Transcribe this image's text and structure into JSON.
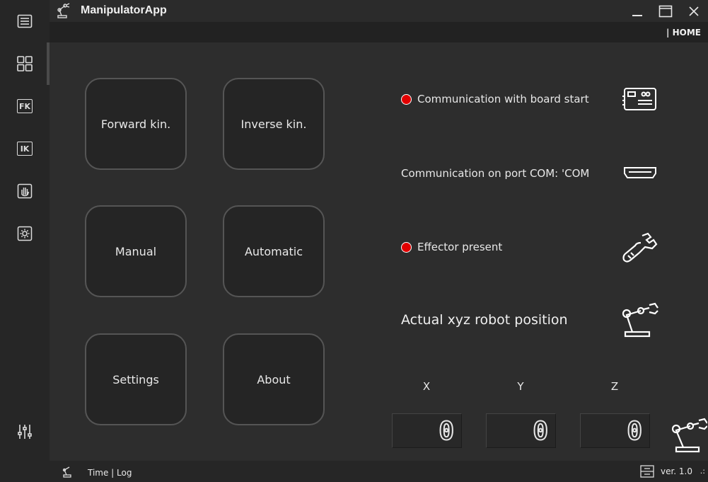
{
  "window": {
    "title": "ManipulatorApp",
    "minimize_icon": "minimize-icon",
    "maximize_icon": "maximize-icon",
    "close_icon": "close-icon"
  },
  "breadcrumb": "| HOME",
  "sidebar": {
    "items": [
      {
        "icon": "menu-icon"
      },
      {
        "icon": "home-grid-icon"
      },
      {
        "text": "FK",
        "icon": "forward-kinematics-icon"
      },
      {
        "text": "IK",
        "icon": "inverse-kinematics-icon"
      },
      {
        "icon": "hand-icon"
      },
      {
        "icon": "settings-gear-icon"
      },
      {
        "icon": "sliders-icon"
      }
    ]
  },
  "tiles": {
    "forward": "Forward kin.",
    "inverse": "Inverse kin.",
    "manual": "Manual",
    "automatic": "Automatic",
    "settings": "Settings",
    "about": "About"
  },
  "status": {
    "board": "Communication with board start",
    "port": "Communication on port COM: 'COM",
    "effector": "Effector present",
    "position_title": "Actual xyz robot position",
    "led_color": "#e10000"
  },
  "position": {
    "x_label": "X",
    "y_label": "Y",
    "z_label": "Z",
    "x": "0",
    "y": "0",
    "z": "0"
  },
  "footer": {
    "log": "Time | Log",
    "version": "ver. 1.0",
    "grip": ".:"
  }
}
